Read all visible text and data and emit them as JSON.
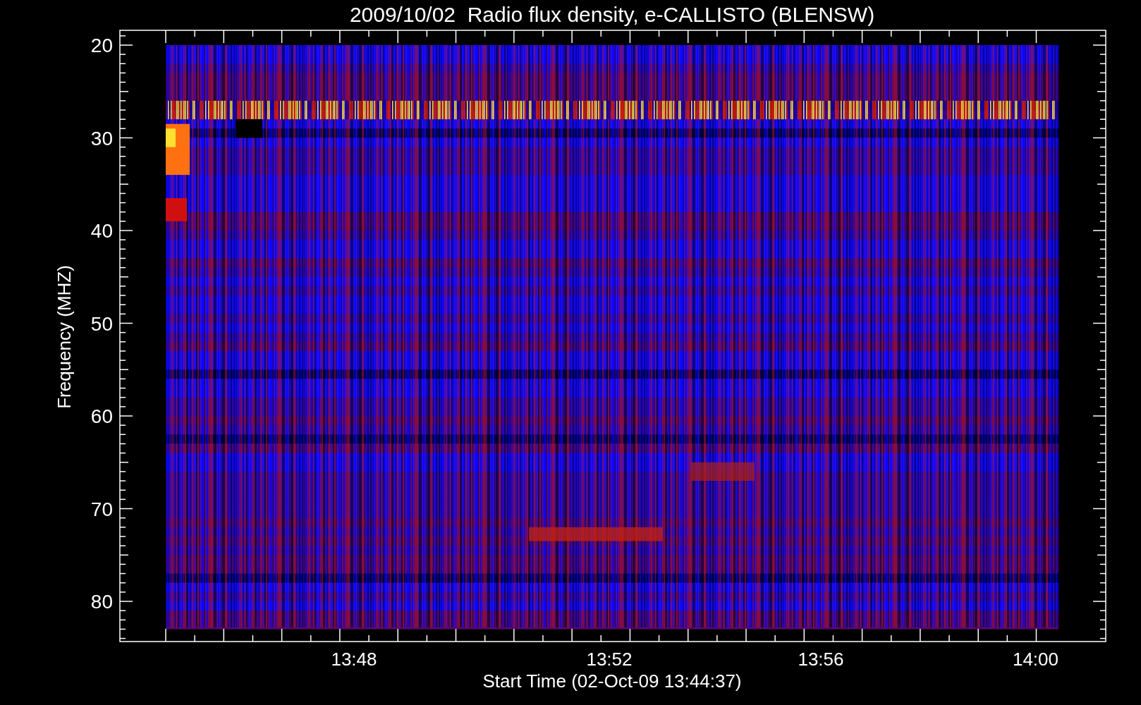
{
  "title": "2009/10/02  Radio flux density, e-CALLISTO (BLENSW)",
  "chart": {
    "ylabel": "Frequency (MHZ)",
    "yticks": [
      "20",
      "30",
      "40",
      "50",
      "60",
      "70",
      "80"
    ],
    "xlabel": "Start Time (02-Oct-09 13:44:37)",
    "xticks": [
      "13:48",
      "13:52",
      "13:56",
      "14:00"
    ]
  }
}
